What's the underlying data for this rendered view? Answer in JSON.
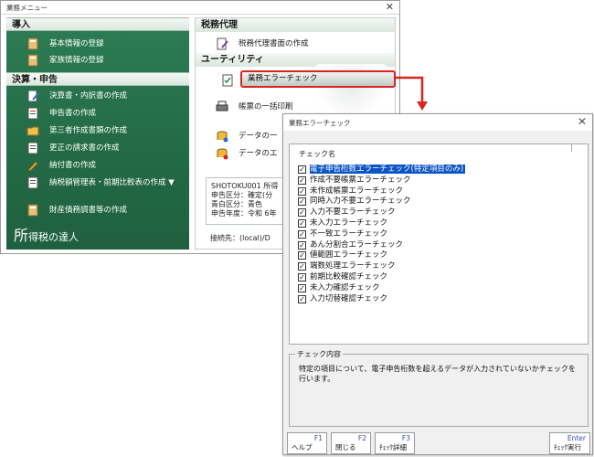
{
  "main_window": {
    "title": "業務メニュー",
    "close_glyph": "✕"
  },
  "left_panel": {
    "section_introduction": "導入",
    "intro_items": [
      {
        "label": "基本情報の登録",
        "icon": "book-icon"
      },
      {
        "label": "家族情報の登録",
        "icon": "book-icon"
      }
    ],
    "section_settlement": "決算・申告",
    "settlement_items": [
      {
        "label": "決算書・内訳書の作成",
        "icon": "document-pen-icon"
      },
      {
        "label": "申告書の作成",
        "icon": "document-icon"
      },
      {
        "label": "第三者作成書類の作成",
        "icon": "folder-icon"
      },
      {
        "label": "更正の請求書の作成",
        "icon": "document-icon"
      },
      {
        "label": "納付書の作成",
        "icon": "pen-icon"
      },
      {
        "label": "納税額管理表・前期比較表の作成 ▼",
        "icon": "document-icon"
      },
      {
        "label": "財産債務調書等の作成",
        "icon": "book-icon"
      }
    ],
    "brand_large": "所",
    "brand_text": "得税の達人"
  },
  "right_panel": {
    "section_tax_agent": "税務代理",
    "tax_agent_items": [
      {
        "label": "税務代理書面の作成",
        "icon": "document-pen-icon"
      }
    ],
    "section_utility": "ユーティリティ",
    "error_check_button": "業務エラーチェック",
    "utility_items": [
      {
        "label": "帳票の一括印刷",
        "icon": "printer-icon"
      },
      {
        "label": "データの一",
        "icon": "database-icon"
      },
      {
        "label": "データのエ",
        "icon": "database-icon"
      }
    ],
    "info_lines": [
      "SHOTOKU001 所得",
      "申告区分：確定(分",
      "青白区分：青色",
      "申告年度：令和 6年"
    ],
    "connection": "接続先：(local)/D"
  },
  "dialog": {
    "title": "業務エラーチェック",
    "close_glyph": "✕",
    "list_header": "チェック名",
    "items": [
      {
        "label": "電子申告桁数エラーチェック(特定項目のみ)",
        "checked": true,
        "selected": true
      },
      {
        "label": "作成不要帳票エラーチェック",
        "checked": true,
        "selected": false
      },
      {
        "label": "未作成帳票エラーチェック",
        "checked": true,
        "selected": false
      },
      {
        "label": "同時入力不要エラーチェック",
        "checked": true,
        "selected": false
      },
      {
        "label": "入力不要エラーチェック",
        "checked": true,
        "selected": false
      },
      {
        "label": "未入力エラーチェック",
        "checked": true,
        "selected": false
      },
      {
        "label": "不一致エラーチェック",
        "checked": true,
        "selected": false
      },
      {
        "label": "あん分割合エラーチェック",
        "checked": true,
        "selected": false
      },
      {
        "label": "値範囲エラーチェック",
        "checked": true,
        "selected": false
      },
      {
        "label": "端数処理エラーチェック",
        "checked": true,
        "selected": false
      },
      {
        "label": "前期比較確認チェック",
        "checked": true,
        "selected": false
      },
      {
        "label": "未入力確認チェック",
        "checked": true,
        "selected": false
      },
      {
        "label": "入力切替確認チェック",
        "checked": true,
        "selected": false
      }
    ],
    "check_content_label": "チェック内容",
    "check_content_text": "特定の項目について、電子申告桁数を超えるデータが入力されていないかチェックを行います。",
    "fkeys": [
      {
        "key": "F1",
        "label": "ヘルプ"
      },
      {
        "key": "F2",
        "label": "閉じる"
      },
      {
        "key": "F3",
        "label": "ﾁｪｯｸ詳細"
      },
      {
        "key": "Enter",
        "label": "ﾁｪｯｸ実行"
      }
    ],
    "check_glyph": "✓"
  },
  "colors": {
    "menu_green": "#2d7d55",
    "highlight_red": "#d8251e",
    "selection_blue": "#0a54c6"
  }
}
